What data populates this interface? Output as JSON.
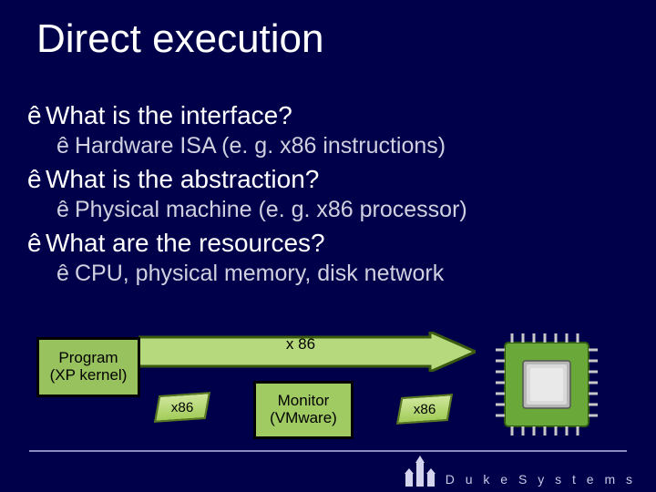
{
  "title": "Direct execution",
  "bullets": [
    {
      "lvl": 1,
      "text": "What is the interface?"
    },
    {
      "lvl": 2,
      "text": "Hardware ISA (e. g. x86 instructions)"
    },
    {
      "lvl": 1,
      "text": "What is the abstraction?"
    },
    {
      "lvl": 2,
      "text": "Physical machine (e. g. x86 processor)"
    },
    {
      "lvl": 1,
      "text": "What are the resources?"
    },
    {
      "lvl": 2,
      "text": "CPU,  physical memory, disk  network"
    }
  ],
  "bullet_char": "ê",
  "diagram": {
    "program_box": "Program\n(XP kernel)",
    "monitor_box": "Monitor\n(VMware)",
    "arrow_label": "x 86",
    "tag1": "x86",
    "tag2": "x86"
  },
  "footer": {
    "brand": "D u k e   S y s t e m s"
  }
}
